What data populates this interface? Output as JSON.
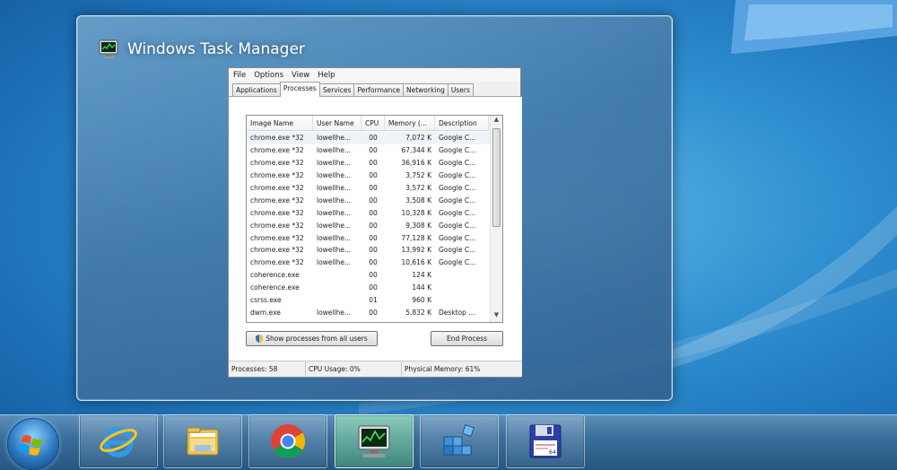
{
  "window": {
    "title": "Windows Task Manager",
    "menu": [
      "File",
      "Options",
      "View",
      "Help"
    ],
    "tabs": [
      "Applications",
      "Processes",
      "Services",
      "Performance",
      "Networking",
      "Users"
    ],
    "active_tab": "Processes",
    "columns": [
      "Image Name",
      "User Name",
      "CPU",
      "Memory (...",
      "Description"
    ],
    "rows": [
      [
        "chrome.exe *32",
        "lowellhe...",
        "00",
        "7,072 K",
        "Google C..."
      ],
      [
        "chrome.exe *32",
        "lowellhe...",
        "00",
        "67,344 K",
        "Google C..."
      ],
      [
        "chrome.exe *32",
        "lowellhe...",
        "00",
        "36,916 K",
        "Google C..."
      ],
      [
        "chrome.exe *32",
        "lowellhe...",
        "00",
        "3,752 K",
        "Google C..."
      ],
      [
        "chrome.exe *32",
        "lowellhe...",
        "00",
        "3,572 K",
        "Google C..."
      ],
      [
        "chrome.exe *32",
        "lowellhe...",
        "00",
        "3,508 K",
        "Google C..."
      ],
      [
        "chrome.exe *32",
        "lowellhe...",
        "00",
        "10,328 K",
        "Google C..."
      ],
      [
        "chrome.exe *32",
        "lowellhe...",
        "00",
        "9,308 K",
        "Google C..."
      ],
      [
        "chrome.exe *32",
        "lowellhe...",
        "00",
        "77,128 K",
        "Google C..."
      ],
      [
        "chrome.exe *32",
        "lowellhe...",
        "00",
        "13,992 K",
        "Google C..."
      ],
      [
        "chrome.exe *32",
        "lowellhe...",
        "00",
        "10,616 K",
        "Google C..."
      ],
      [
        "coherence.exe",
        "",
        "00",
        "124 K",
        ""
      ],
      [
        "coherence.exe",
        "",
        "00",
        "144 K",
        ""
      ],
      [
        "csrss.exe",
        "",
        "01",
        "960 K",
        ""
      ],
      [
        "dwm.exe",
        "lowellhe...",
        "00",
        "5,832 K",
        "Desktop ..."
      ]
    ],
    "show_all_label": "Show processes from all users",
    "end_process_label": "End Process",
    "status": {
      "processes": "Processes: 58",
      "cpu": "CPU Usage: 0%",
      "memory": "Physical Memory: 61%"
    }
  },
  "taskbar": {
    "buttons": [
      {
        "icon": "internet-explorer-icon"
      },
      {
        "icon": "file-explorer-icon"
      },
      {
        "icon": "chrome-icon"
      },
      {
        "icon": "task-manager-icon",
        "active": true
      },
      {
        "icon": "registry-editor-icon"
      },
      {
        "icon": "floppy-disk-64-icon"
      }
    ],
    "floppy_badge": "64"
  },
  "colors": {
    "desktop": "#2f8fd0",
    "taskbar": "#3a6f9c",
    "active_button": "#5fb889"
  }
}
